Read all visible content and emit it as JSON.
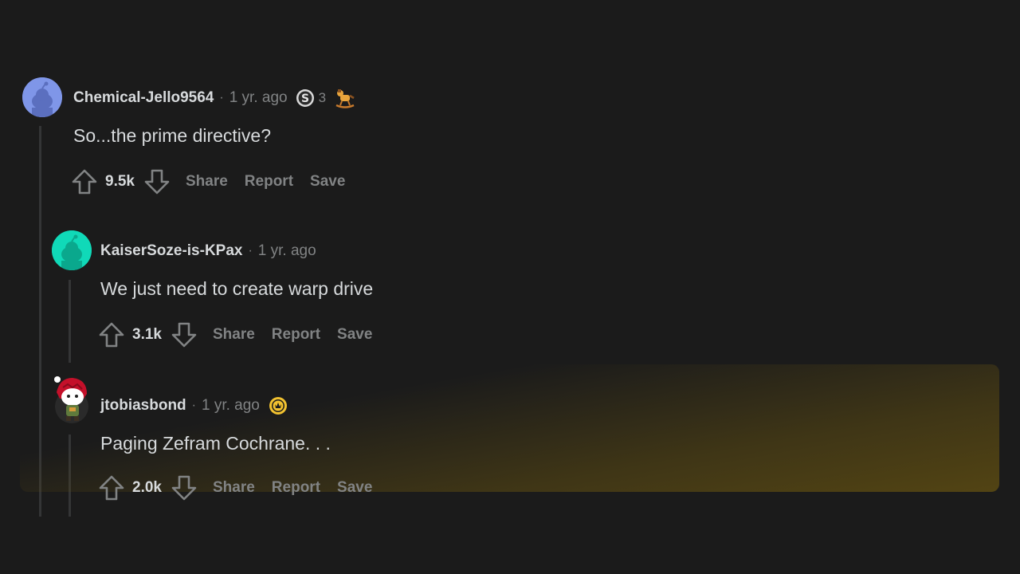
{
  "comments": [
    {
      "username": "Chemical-Jello9564",
      "separator": "·",
      "time": "1 yr. ago",
      "badge_count": "3",
      "body": "So...the prime directive?",
      "score": "9.5k",
      "share_label": "Share",
      "report_label": "Report",
      "save_label": "Save",
      "avatar_color": "#7f96e8",
      "icons": [
        "snoo-avatar-icon",
        "silver-award-icon",
        "rocking-horse-award-icon",
        "upvote-icon",
        "downvote-icon"
      ]
    },
    {
      "username": "KaiserSoze-is-KPax",
      "separator": "·",
      "time": "1 yr. ago",
      "body": "We just need to create warp drive",
      "score": "3.1k",
      "share_label": "Share",
      "report_label": "Report",
      "save_label": "Save",
      "avatar_color": "#10d9b8",
      "icons": [
        "snoo-avatar-icon",
        "upvote-icon",
        "downvote-icon"
      ]
    },
    {
      "username": "jtobiasbond",
      "separator": "·",
      "time": "1 yr. ago",
      "body": "Paging Zefram Cochrane. . .",
      "score": "2.0k",
      "share_label": "Share",
      "report_label": "Report",
      "save_label": "Save",
      "highlight_color": "#5c4b12",
      "icons": [
        "custom-snoo-avatar-icon",
        "gold-award-icon",
        "upvote-icon",
        "downvote-icon"
      ]
    }
  ],
  "colors": {
    "background": "#1b1b1b",
    "text": "#d7dadc",
    "muted": "#818384",
    "thread_line": "#343536"
  }
}
